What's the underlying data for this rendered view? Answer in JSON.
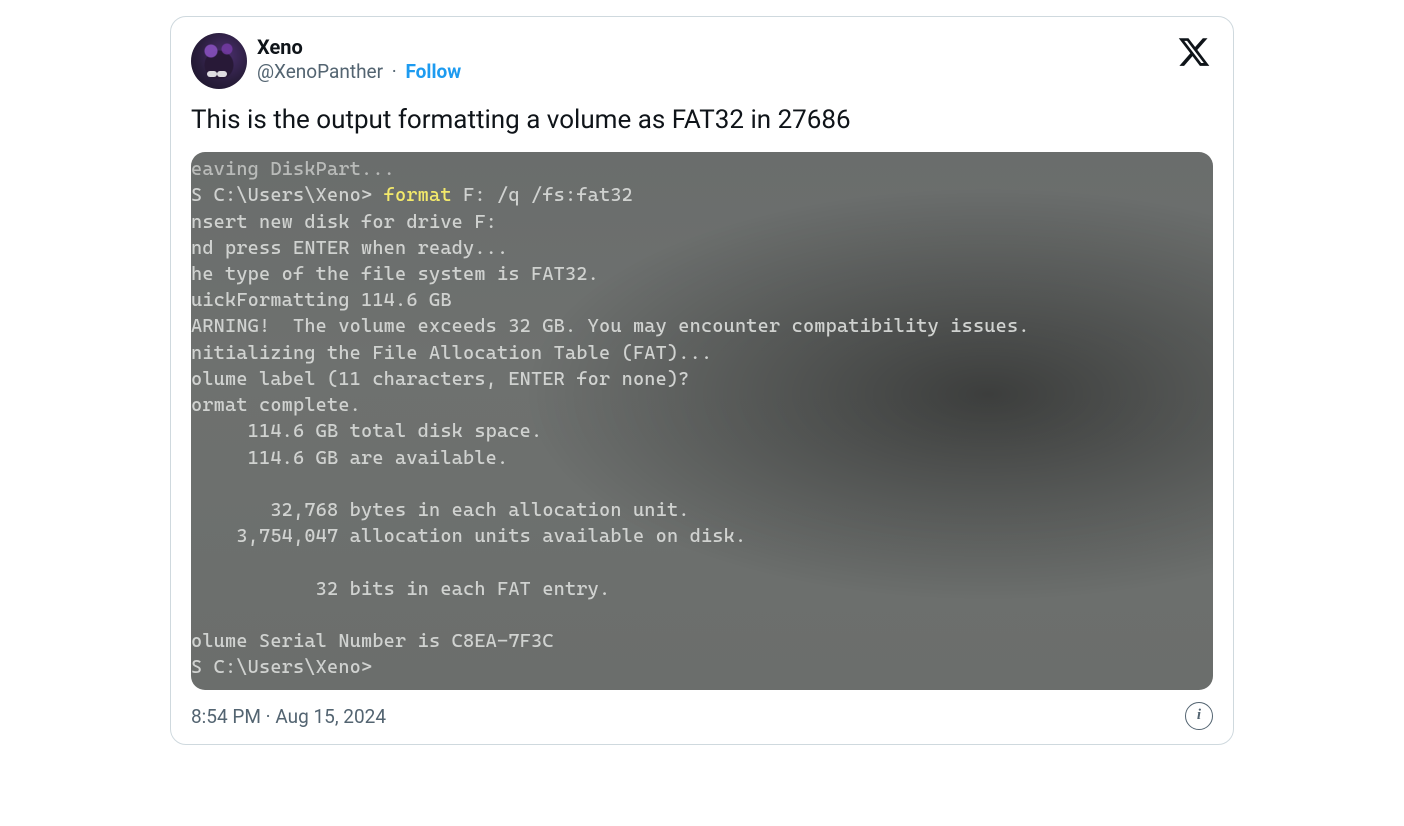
{
  "author": {
    "display_name": "Xeno",
    "handle": "@XenoPanther",
    "separator": "·",
    "follow_label": "Follow"
  },
  "tweet": {
    "text": "This is the output formatting a volume as FAT32 in 27686"
  },
  "terminal": {
    "line_leaving": "eaving DiskPart...",
    "prompt1_prefix": "S C:\\Users\\Xeno> ",
    "prompt1_cmd": "format",
    "prompt1_args": " F: /q /fs:fat32",
    "body": "nsert new disk for drive F:\nnd press ENTER when ready...\nhe type of the file system is FAT32.\nuickFormatting 114.6 GB\nARNING!  The volume exceeds 32 GB. You may encounter compatibility issues.\nnitializing the File Allocation Table (FAT)...\nolume label (11 characters, ENTER for none)?\normat complete.\n     114.6 GB total disk space.\n     114.6 GB are available.\n\n       32,768 bytes in each allocation unit.\n    3,754,047 allocation units available on disk.\n\n           32 bits in each FAT entry.\n\nolume Serial Number is C8EA-7F3C",
    "prompt2": "S C:\\Users\\Xeno>"
  },
  "meta": {
    "time": "8:54 PM",
    "dot": "·",
    "date": "Aug 15, 2024",
    "info_glyph": "i"
  }
}
